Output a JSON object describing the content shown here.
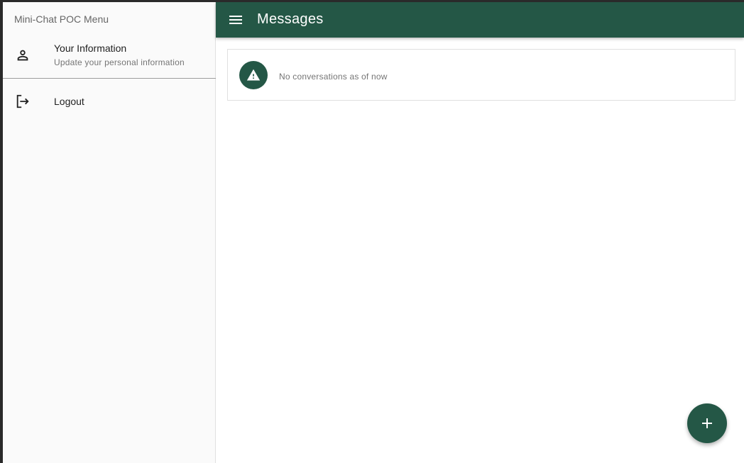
{
  "sidebar": {
    "title": "Mini-Chat POC Menu",
    "items": [
      {
        "label": "Your Information",
        "subtitle": "Update your personal information",
        "icon": "person-icon"
      },
      {
        "label": "Logout",
        "icon": "logout-icon"
      }
    ]
  },
  "toolbar": {
    "title": "Messages",
    "menu_icon": "menu-icon"
  },
  "conversations": {
    "empty_message": "No conversations as of now",
    "empty_icon": "warning-icon"
  },
  "fab": {
    "icon": "add-icon"
  },
  "colors": {
    "primary": "#245746",
    "sidebar_bg": "#fafafa",
    "divider": "#9e9e9e"
  }
}
